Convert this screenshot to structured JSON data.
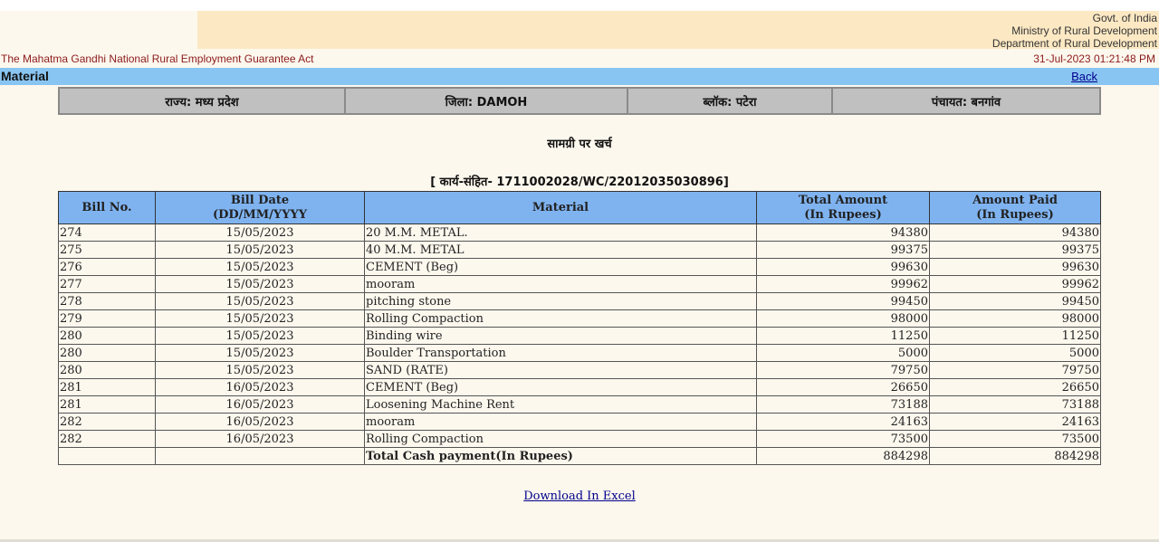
{
  "header": {
    "gov_lines": [
      "Govt. of India",
      "Ministry of Rural Development",
      "Department of Rural Development"
    ],
    "act_title": "The Mahatma Gandhi National Rural Employment Guarantee Act",
    "datetime": "31-Jul-2023 01:21:48 PM"
  },
  "titlebar": {
    "title": "Material",
    "back_label": "Back"
  },
  "location": {
    "state": "राज्य: मध्य प्रदेश",
    "district": "जिला: DAMOH",
    "block": "ब्लॉक: पटेरा",
    "panchayat": "पंचायत: बनगांव"
  },
  "heading": "सामग्री पर खर्च",
  "work_code": "[ कार्य-संहित- 1711002028/WC/22012035030896]",
  "table": {
    "columns": {
      "bill_no": "Bill No.",
      "bill_date_1": "Bill Date",
      "bill_date_2": "(DD/MM/YYYY",
      "material": "Material",
      "total_1": "Total Amount",
      "total_2": "(In Rupees)",
      "paid_1": "Amount Paid",
      "paid_2": "(In Rupees)"
    },
    "rows": [
      {
        "bill_no": "274",
        "date": "15/05/2023",
        "material": "20 M.M. METAL.",
        "total": "94380",
        "paid": "94380"
      },
      {
        "bill_no": "275",
        "date": "15/05/2023",
        "material": "40 M.M. METAL",
        "total": "99375",
        "paid": "99375"
      },
      {
        "bill_no": "276",
        "date": "15/05/2023",
        "material": "CEMENT (Beg)",
        "total": "99630",
        "paid": "99630"
      },
      {
        "bill_no": "277",
        "date": "15/05/2023",
        "material": "mooram",
        "total": "99962",
        "paid": "99962"
      },
      {
        "bill_no": "278",
        "date": "15/05/2023",
        "material": "pitching stone",
        "total": "99450",
        "paid": "99450"
      },
      {
        "bill_no": "279",
        "date": "15/05/2023",
        "material": "Rolling Compaction",
        "total": "98000",
        "paid": "98000"
      },
      {
        "bill_no": "280",
        "date": "15/05/2023",
        "material": "Binding wire",
        "total": "11250",
        "paid": "11250"
      },
      {
        "bill_no": "280",
        "date": "15/05/2023",
        "material": "Boulder Transportation",
        "total": "5000",
        "paid": "5000"
      },
      {
        "bill_no": "280",
        "date": "15/05/2023",
        "material": "SAND (RATE)",
        "total": "79750",
        "paid": "79750"
      },
      {
        "bill_no": "281",
        "date": "16/05/2023",
        "material": "CEMENT (Beg)",
        "total": "26650",
        "paid": "26650"
      },
      {
        "bill_no": "281",
        "date": "16/05/2023",
        "material": "Loosening Machine Rent",
        "total": "73188",
        "paid": "73188"
      },
      {
        "bill_no": "282",
        "date": "16/05/2023",
        "material": "mooram",
        "total": "24163",
        "paid": "24163"
      },
      {
        "bill_no": "282",
        "date": "16/05/2023",
        "material": "Rolling Compaction",
        "total": "73500",
        "paid": "73500"
      }
    ],
    "total_label": "Total Cash payment(In Rupees)",
    "total_amount": "884298",
    "total_paid": "884298"
  },
  "excel_link": "Download In Excel"
}
